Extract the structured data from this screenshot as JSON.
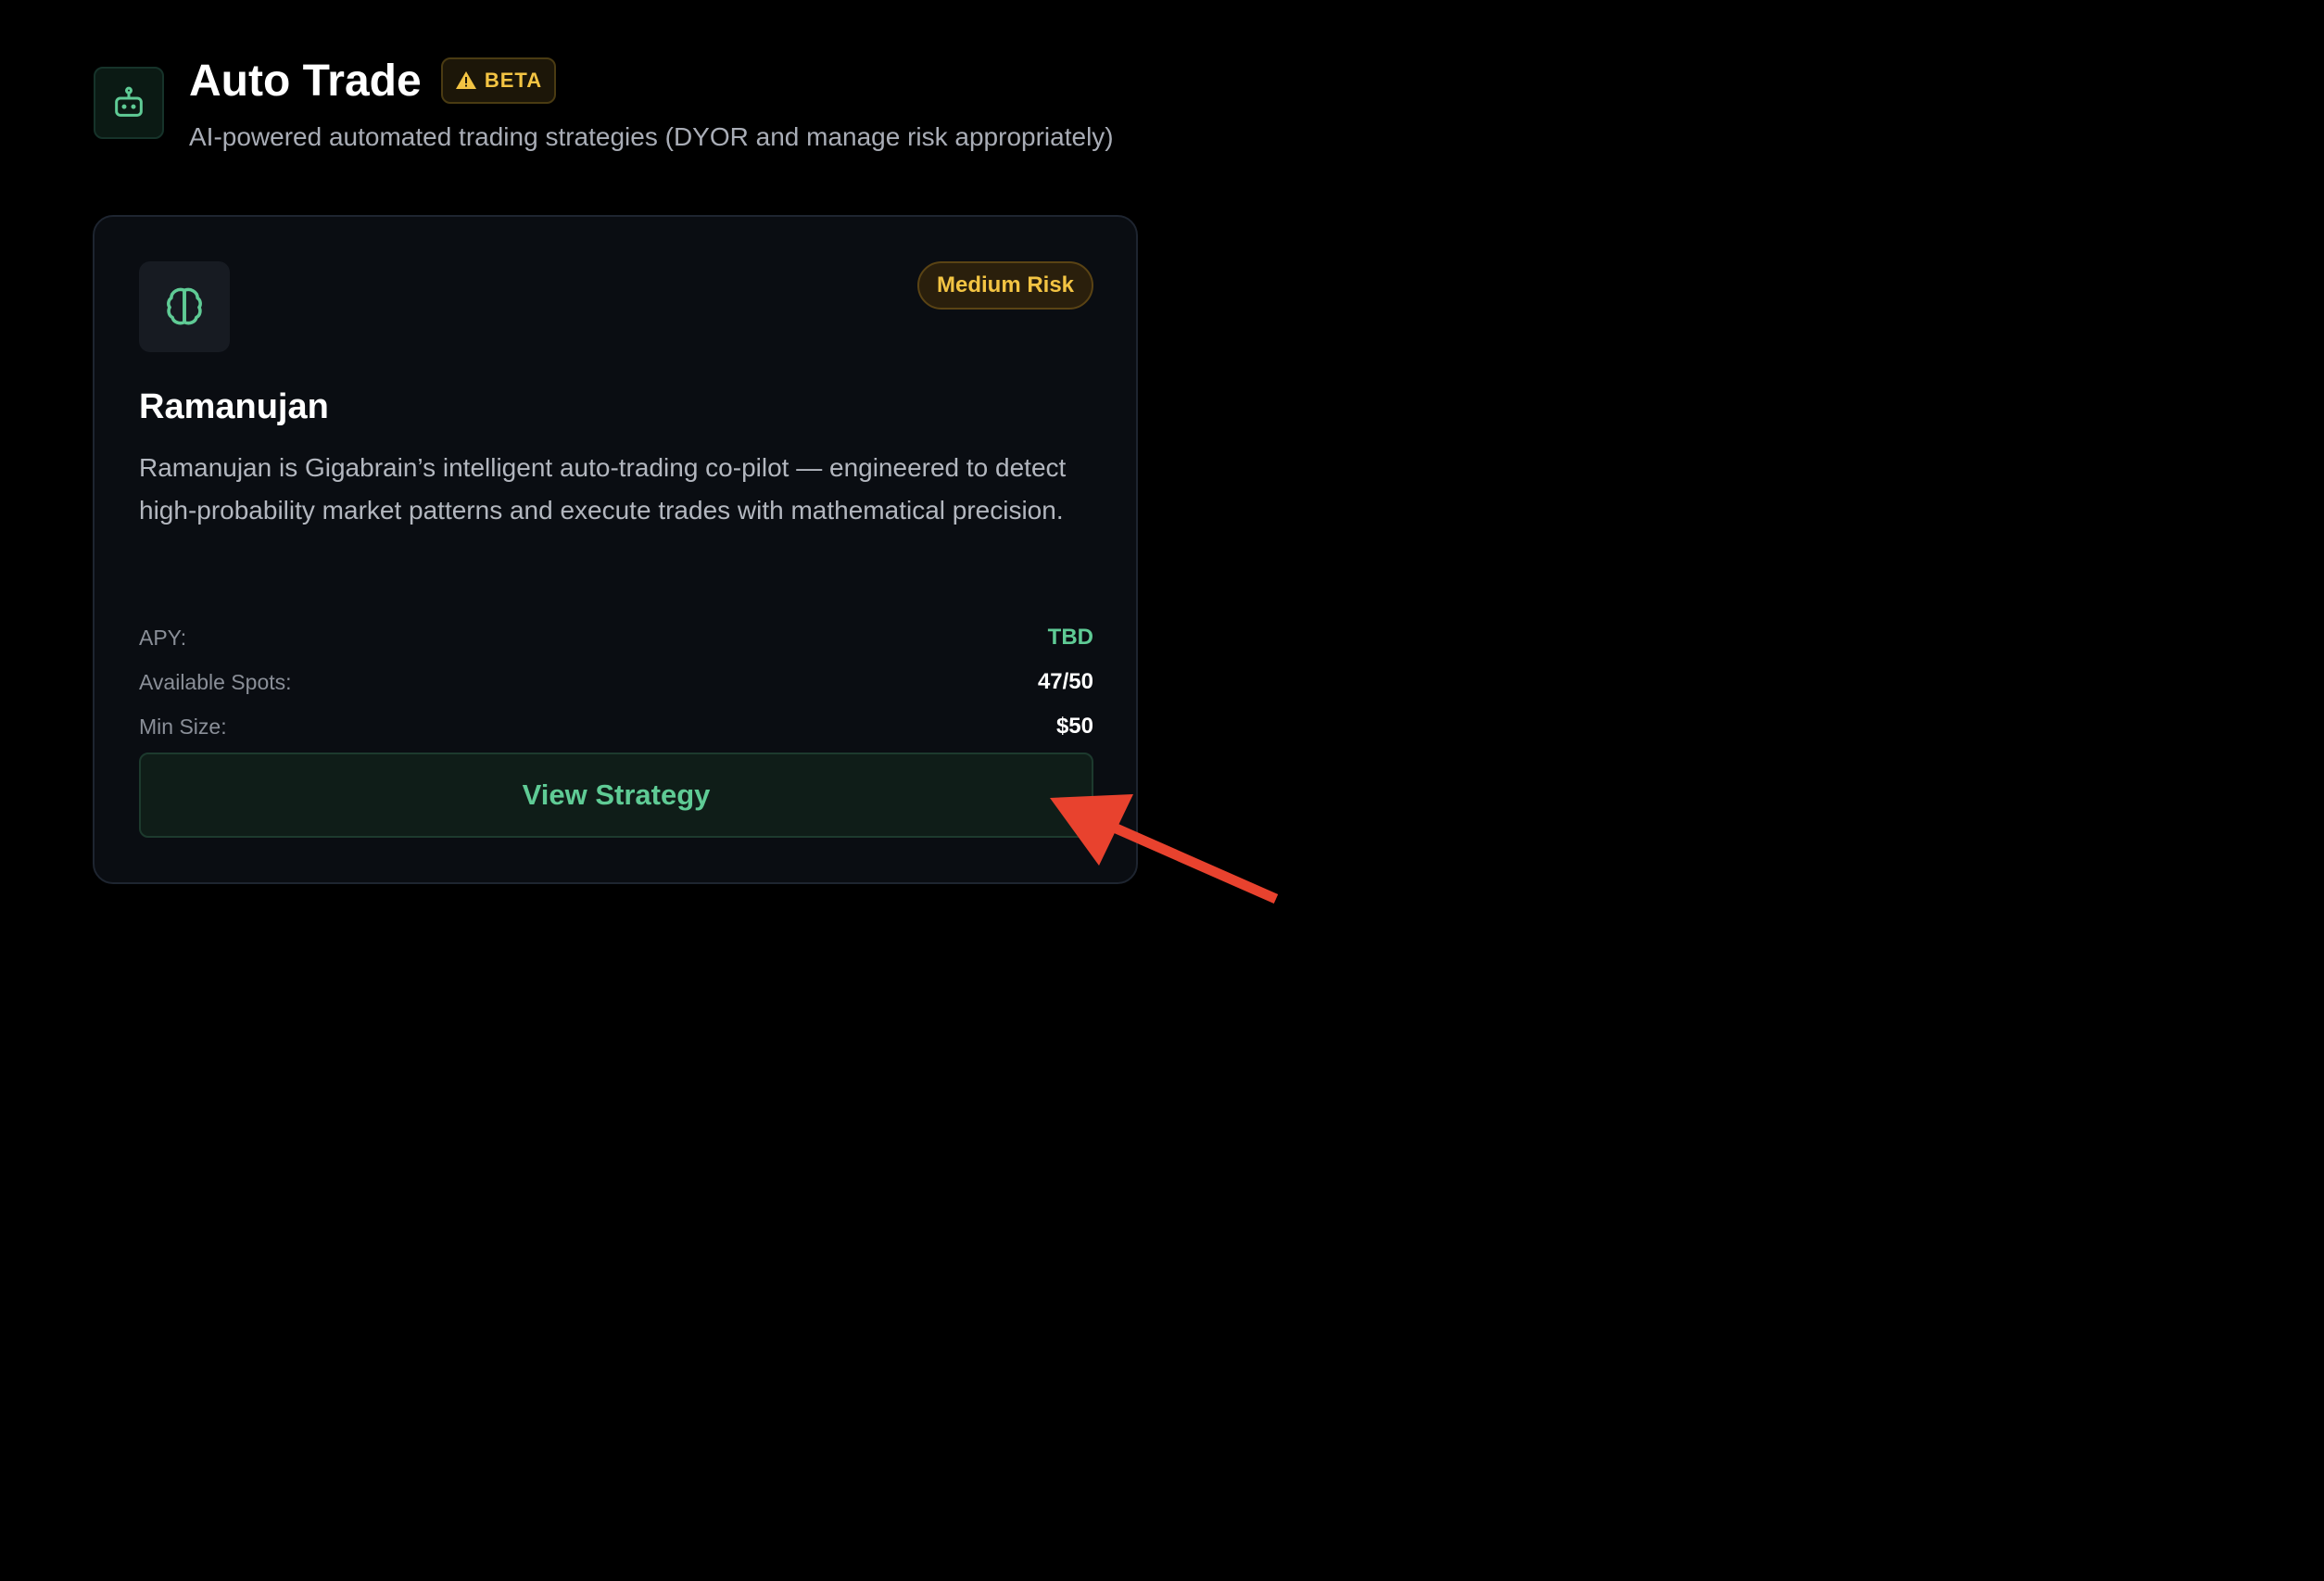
{
  "header": {
    "icon": "robot-icon",
    "title": "Auto Trade",
    "badge_icon": "warning-icon",
    "badge_label": "BETA",
    "subtitle": "AI-powered automated trading strategies (DYOR and manage risk appropriately)"
  },
  "strategy_card": {
    "icon": "brain-icon",
    "risk_label": "Medium Risk",
    "name": "Ramanujan",
    "description": "Ramanujan is Gigabrain’s intelligent auto-trading co-pilot — engineered to detect high-probability market patterns and execute trades with mathematical precision.",
    "stats": [
      {
        "label": "APY:",
        "value": "TBD"
      },
      {
        "label": "Available Spots:",
        "value": "47/50"
      },
      {
        "label": "Min Size:",
        "value": "$50"
      }
    ],
    "button_label": "View Strategy"
  },
  "colors": {
    "background": "#000000",
    "card": "#0a0d12",
    "accent_green": "#5fcb95",
    "warning_yellow": "#f3c443",
    "annotation_red": "#e8422e"
  },
  "annotation": {
    "icon": "red-arrow-pointer"
  }
}
